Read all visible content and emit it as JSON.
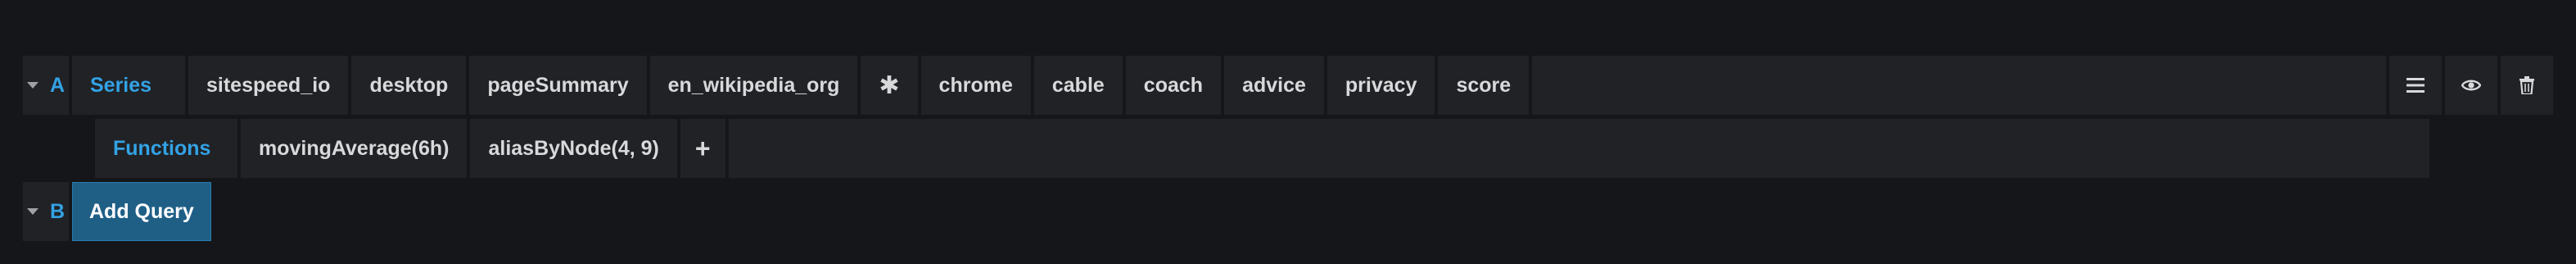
{
  "queryA": {
    "letter": "A",
    "series_label": "Series",
    "segments": [
      "sitespeed_io",
      "desktop",
      "pageSummary",
      "en_wikipedia_org",
      "✱",
      "chrome",
      "cable",
      "coach",
      "advice",
      "privacy",
      "score"
    ],
    "functions_label": "Functions",
    "functions": [
      "movingAverage(6h)",
      "aliasByNode(4, 9)"
    ],
    "add_function": "+",
    "actions": [
      "menu-icon",
      "eye-icon",
      "trash-icon"
    ]
  },
  "queryB": {
    "letter": "B",
    "add_query_label": "Add Query"
  },
  "colors": {
    "background": "#141619",
    "segment": "#202226",
    "keyword": "#33a2e5",
    "text": "#d8d9da",
    "button": "#1f5f86"
  }
}
